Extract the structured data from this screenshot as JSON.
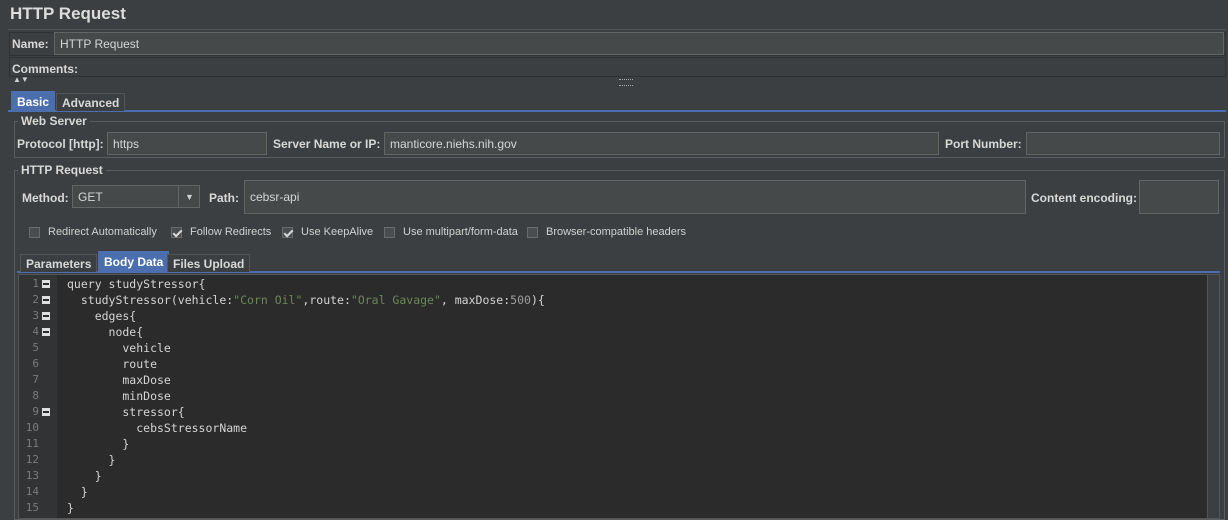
{
  "panel_title": "HTTP Request",
  "name_label": "Name:",
  "name_value": "HTTP Request",
  "comments_label": "Comments:",
  "main_tabs": [
    "Basic",
    "Advanced"
  ],
  "web_server": {
    "title": "Web Server",
    "protocol_label": "Protocol [http]:",
    "protocol_value": "https",
    "server_label": "Server Name or IP:",
    "server_value": "manticore.niehs.nih.gov",
    "port_label": "Port Number:",
    "port_value": ""
  },
  "http_request": {
    "title": "HTTP Request",
    "method_label": "Method:",
    "method_value": "GET",
    "path_label": "Path:",
    "path_value": "cebsr-api",
    "encoding_label": "Content encoding:",
    "encoding_value": ""
  },
  "checkboxes": [
    {
      "label": "Redirect Automatically",
      "checked": false
    },
    {
      "label": "Follow Redirects",
      "checked": true
    },
    {
      "label": "Use KeepAlive",
      "checked": true
    },
    {
      "label": "Use multipart/form-data",
      "checked": false
    },
    {
      "label": "Browser-compatible headers",
      "checked": false
    }
  ],
  "sub_tabs": [
    "Parameters",
    "Body Data",
    "Files Upload"
  ],
  "code_lines": [
    {
      "n": "1",
      "fold": true,
      "text": "query studyStressor{"
    },
    {
      "n": "2",
      "fold": true,
      "text": "  studyStressor(vehicle:\"Corn Oil\",route:\"Oral Gavage\", maxDose:500){"
    },
    {
      "n": "3",
      "fold": true,
      "text": "    edges{"
    },
    {
      "n": "4",
      "fold": true,
      "text": "      node{"
    },
    {
      "n": "5",
      "fold": false,
      "text": "        vehicle"
    },
    {
      "n": "6",
      "fold": false,
      "text": "        route"
    },
    {
      "n": "7",
      "fold": false,
      "text": "        maxDose"
    },
    {
      "n": "8",
      "fold": false,
      "text": "        minDose"
    },
    {
      "n": "9",
      "fold": true,
      "text": "        stressor{"
    },
    {
      "n": "10",
      "fold": false,
      "text": "          cebsStressorName"
    },
    {
      "n": "11",
      "fold": false,
      "text": "        }"
    },
    {
      "n": "12",
      "fold": false,
      "text": "      }"
    },
    {
      "n": "13",
      "fold": false,
      "text": "    }"
    },
    {
      "n": "14",
      "fold": false,
      "text": "  }"
    },
    {
      "n": "15",
      "fold": false,
      "text": "}"
    }
  ]
}
